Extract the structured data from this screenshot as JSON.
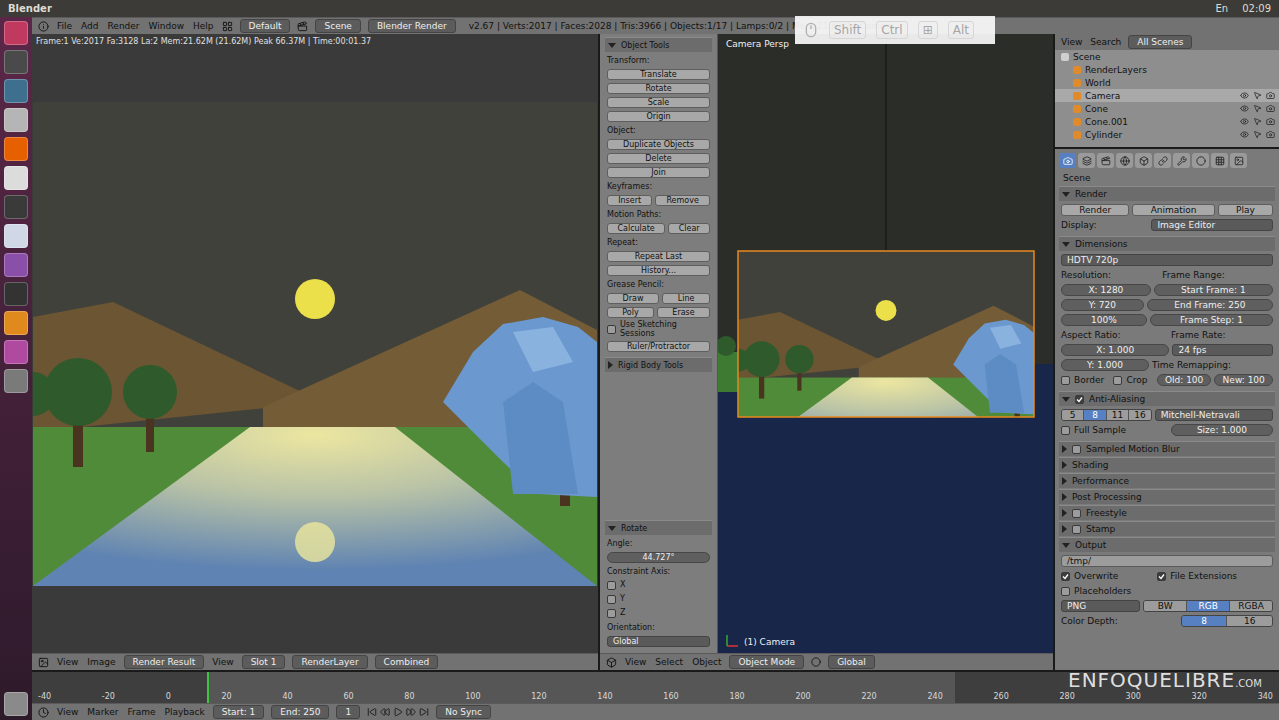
{
  "os_bar": {
    "title": "Blender",
    "tray": [
      "En",
      "02:09"
    ]
  },
  "launcher": {
    "items": [
      {
        "color": "#c0395f"
      },
      {
        "color": "#4a4a4a"
      },
      {
        "color": "#3f6f8f"
      },
      {
        "color": "#b5b5b5"
      },
      {
        "color": "#e66000"
      },
      {
        "color": "#dcdcdc"
      },
      {
        "color": "#3a3a3a"
      },
      {
        "color": "#d0d8e8"
      },
      {
        "color": "#8a4fa8"
      },
      {
        "color": "#333333"
      },
      {
        "color": "#e08a1e"
      },
      {
        "color": "#b04aa0"
      },
      {
        "color": "#7a7a7a"
      }
    ],
    "bottom_item": {
      "color": "#8a8a8a"
    }
  },
  "info_header": {
    "menus": [
      "File",
      "Add",
      "Render",
      "Window",
      "Help"
    ],
    "layout": "Default",
    "scene": "Scene",
    "engine": "Blender Render",
    "stats": "v2.67 | Verts:2017 | Faces:2028 | Tris:3966 | Objects:1/17 | Lamps:0/2 | Mem:21.62M | Camera"
  },
  "key_overlay": {
    "keys": [
      {
        "label": "Shift",
        "pressed": false
      },
      {
        "label": "Ctrl",
        "pressed": false
      },
      {
        "label": "⊞",
        "pressed": false
      },
      {
        "label": "Alt",
        "pressed": false
      }
    ]
  },
  "image_editor": {
    "info": "Frame:1 Ve:2017 Fa:3128 La:2 Mem:21.62M (21.62M) Peak 66.37M | Time:00:01.37",
    "menus": [
      "View",
      "Image"
    ],
    "image": "Render Result",
    "view": "View",
    "slot": "Slot 1",
    "layer": "RenderLayer",
    "pass": "Combined"
  },
  "tool_shelf": {
    "panels": [
      {
        "title": "Object Tools",
        "expanded": true,
        "rows": [
          {
            "cells": [
              {
                "type": "label",
                "text": "Transform:"
              }
            ]
          },
          {
            "cells": [
              {
                "type": "button",
                "text": "Translate"
              }
            ]
          },
          {
            "cells": [
              {
                "type": "button",
                "text": "Rotate"
              }
            ]
          },
          {
            "cells": [
              {
                "type": "button",
                "text": "Scale"
              }
            ]
          },
          {
            "cells": [
              {
                "type": "button",
                "text": "Origin"
              }
            ]
          },
          {
            "cells": [
              {
                "type": "label",
                "text": "Object:"
              }
            ]
          },
          {
            "cells": [
              {
                "type": "button",
                "text": "Duplicate Objects"
              }
            ]
          },
          {
            "cells": [
              {
                "type": "button",
                "text": "Delete"
              }
            ]
          },
          {
            "cells": [
              {
                "type": "button",
                "text": "Join"
              }
            ]
          },
          {
            "cells": [
              {
                "type": "label",
                "text": "Keyframes:"
              }
            ]
          },
          {
            "cells": [
              {
                "type": "button",
                "text": "Insert"
              },
              {
                "type": "button",
                "text": "Remove"
              }
            ]
          },
          {
            "cells": [
              {
                "type": "label",
                "text": "Motion Paths:"
              }
            ]
          },
          {
            "cells": [
              {
                "type": "button",
                "text": "Calculate"
              },
              {
                "type": "button",
                "text": "Clear"
              }
            ]
          },
          {
            "cells": [
              {
                "type": "label",
                "text": "Repeat:"
              }
            ]
          },
          {
            "cells": [
              {
                "type": "button",
                "text": "Repeat Last"
              }
            ]
          },
          {
            "cells": [
              {
                "type": "button",
                "text": "History..."
              }
            ]
          },
          {
            "cells": [
              {
                "type": "label",
                "text": "Grease Pencil:"
              }
            ]
          },
          {
            "cells": [
              {
                "type": "button",
                "text": "Draw"
              },
              {
                "type": "button",
                "text": "Line"
              }
            ]
          },
          {
            "cells": [
              {
                "type": "button",
                "text": "Poly"
              },
              {
                "type": "button",
                "text": "Erase"
              }
            ]
          },
          {
            "cells": [
              {
                "type": "check",
                "text": "Use Sketching Sessions",
                "checked": false
              }
            ]
          },
          {
            "cells": [
              {
                "type": "button",
                "text": "Ruler/Protractor"
              }
            ]
          }
        ]
      },
      {
        "title": "Rigid Body Tools",
        "expanded": false,
        "rows": []
      }
    ],
    "operator": {
      "title": "Rotate",
      "expanded": true,
      "rows": [
        {
          "cells": [
            {
              "type": "label",
              "text": "Angle:"
            }
          ]
        },
        {
          "cells": [
            {
              "type": "number",
              "text": "44.727°"
            }
          ]
        },
        {
          "cells": [
            {
              "type": "label",
              "text": "Constraint Axis:"
            }
          ]
        },
        {
          "cells": [
            {
              "type": "check",
              "text": "X",
              "checked": false
            }
          ]
        },
        {
          "cells": [
            {
              "type": "check",
              "text": "Y",
              "checked": false
            }
          ]
        },
        {
          "cells": [
            {
              "type": "check",
              "text": "Z",
              "checked": false
            }
          ]
        },
        {
          "cells": [
            {
              "type": "label",
              "text": "Orientation:"
            }
          ]
        },
        {
          "cells": [
            {
              "type": "dropdown",
              "text": "Global"
            }
          ]
        }
      ]
    }
  },
  "viewport": {
    "label": "Camera Persp",
    "object": "(1) Camera",
    "menus": [
      "View",
      "Select",
      "Object"
    ],
    "mode": "Object Mode",
    "orientation": "Global"
  },
  "outliner": {
    "menus": [
      "View",
      "Search"
    ],
    "filter": "All Scenes",
    "items": [
      {
        "label": "Scene",
        "depth": 0,
        "selected": false,
        "restrict": false
      },
      {
        "label": "RenderLayers",
        "depth": 1,
        "selected": false,
        "restrict": false
      },
      {
        "label": "World",
        "depth": 1,
        "selected": false,
        "restrict": false
      },
      {
        "label": "Camera",
        "depth": 1,
        "selected": true,
        "restrict": true
      },
      {
        "label": "Cone",
        "depth": 1,
        "selected": false,
        "restrict": true
      },
      {
        "label": "Cone.001",
        "depth": 1,
        "selected": false,
        "restrict": true
      },
      {
        "label": "Cylinder",
        "depth": 1,
        "selected": false,
        "restrict": true
      }
    ]
  },
  "properties": {
    "tabs": [
      {
        "selected": true
      },
      {
        "selected": false
      },
      {
        "selected": false
      },
      {
        "selected": false
      },
      {
        "selected": false
      },
      {
        "selected": false
      },
      {
        "selected": false
      },
      {
        "selected": false
      },
      {
        "selected": false
      },
      {
        "selected": false
      }
    ],
    "context": "Scene",
    "panels": [
      {
        "title": "Render",
        "expanded": true,
        "rows": [
          {
            "cells": [
              {
                "type": "button",
                "text": "Render"
              },
              {
                "type": "button",
                "text": "Animation"
              },
              {
                "type": "button",
                "text": "Play"
              }
            ]
          },
          {
            "cells": [
              {
                "type": "label",
                "text": "Display:"
              },
              {
                "type": "dropdown",
                "text": "Image Editor"
              }
            ]
          }
        ]
      },
      {
        "title": "Dimensions",
        "expanded": true,
        "rows": [
          {
            "cells": [
              {
                "type": "dropdown",
                "text": "HDTV 720p"
              }
            ]
          },
          {
            "cells": [
              {
                "type": "label",
                "text": "Resolution:"
              },
              {
                "type": "label",
                "text": "Frame Range:"
              }
            ]
          },
          {
            "cells": [
              {
                "type": "number",
                "text": "X: 1280"
              },
              {
                "type": "number",
                "text": "Start Frame: 1"
              }
            ]
          },
          {
            "cells": [
              {
                "type": "number",
                "text": "Y: 720"
              },
              {
                "type": "number",
                "text": "End Frame: 250"
              }
            ]
          },
          {
            "cells": [
              {
                "type": "number",
                "text": "100%"
              },
              {
                "type": "number",
                "text": "Frame Step: 1"
              }
            ]
          },
          {
            "cells": [
              {
                "type": "label",
                "text": "Aspect Ratio:"
              },
              {
                "type": "label",
                "text": "Frame Rate:"
              }
            ]
          },
          {
            "cells": [
              {
                "type": "number",
                "text": "X: 1.000"
              },
              {
                "type": "dropdown",
                "text": "24 fps"
              }
            ]
          },
          {
            "cells": [
              {
                "type": "number",
                "text": "Y: 1.000"
              },
              {
                "type": "label",
                "text": "Time Remapping:"
              }
            ]
          },
          {
            "cells": [
              {
                "type": "check",
                "text": "Border",
                "checked": false
              },
              {
                "type": "check",
                "text": "Crop",
                "checked": false
              },
              {
                "type": "number",
                "text": "Old: 100"
              },
              {
                "type": "number",
                "text": "New: 100"
              }
            ]
          }
        ]
      },
      {
        "title": "Anti-Aliasing",
        "expanded": true,
        "checked": true,
        "rows": [
          {
            "cells": [
              {
                "type": "toggles",
                "items": [
                  {
                    "label": "5",
                    "selected": false
                  },
                  {
                    "label": "8",
                    "selected": true
                  },
                  {
                    "label": "11",
                    "selected": false
                  },
                  {
                    "label": "16",
                    "selected": false
                  }
                ]
              },
              {
                "type": "dropdown",
                "text": "Mitchell-Netravali"
              }
            ]
          },
          {
            "cells": [
              {
                "type": "check",
                "text": "Full Sample",
                "checked": false
              },
              {
                "type": "number",
                "text": "Size: 1.000"
              }
            ]
          }
        ]
      },
      {
        "title": "Sampled Motion Blur",
        "expanded": false,
        "checked": false,
        "rows": []
      },
      {
        "title": "Shading",
        "expanded": false,
        "rows": []
      },
      {
        "title": "Performance",
        "expanded": false,
        "rows": []
      },
      {
        "title": "Post Processing",
        "expanded": false,
        "rows": []
      },
      {
        "title": "Freestyle",
        "expanded": false,
        "checked": false,
        "rows": []
      },
      {
        "title": "Stamp",
        "expanded": false,
        "checked": false,
        "rows": []
      },
      {
        "title": "Output",
        "expanded": true,
        "rows": [
          {
            "cells": [
              {
                "type": "path",
                "text": "/tmp/"
              }
            ]
          },
          {
            "cells": [
              {
                "type": "check",
                "text": "Overwrite",
                "checked": true
              },
              {
                "type": "check",
                "text": "File Extensions",
                "checked": true
              }
            ]
          },
          {
            "cells": [
              {
                "type": "check",
                "text": "Placeholders",
                "checked": false
              }
            ]
          },
          {
            "cells": [
              {
                "type": "dropdown",
                "text": "PNG"
              },
              {
                "type": "toggles",
                "items": [
                  {
                    "label": "BW",
                    "selected": false
                  },
                  {
                    "label": "RGB",
                    "selected": true
                  },
                  {
                    "label": "RGBA",
                    "selected": false
                  }
                ]
              }
            ]
          },
          {
            "cells": [
              {
                "type": "label",
                "text": "Color Depth:"
              },
              {
                "type": "toggles",
                "items": [
                  {
                    "label": "8",
                    "selected": true
                  },
                  {
                    "label": "16",
                    "selected": false
                  }
                ]
              }
            ]
          }
        ]
      }
    ]
  },
  "timeline": {
    "ticks": [
      "-40",
      "-20",
      "0",
      "20",
      "40",
      "60",
      "80",
      "100",
      "120",
      "140",
      "160",
      "180",
      "200",
      "220",
      "240",
      "260",
      "280",
      "300",
      "320",
      "340"
    ],
    "current_level": 0.14,
    "range": {
      "start": 0.14,
      "end": 0.74
    },
    "menus": [
      "View",
      "Marker",
      "Frame",
      "Playback"
    ],
    "start": "Start: 1",
    "end": "End: 250",
    "frame": "1",
    "sync": "No Sync"
  },
  "watermark": {
    "main": "ENFOQUELIBRE",
    "suffix": ".COM"
  }
}
